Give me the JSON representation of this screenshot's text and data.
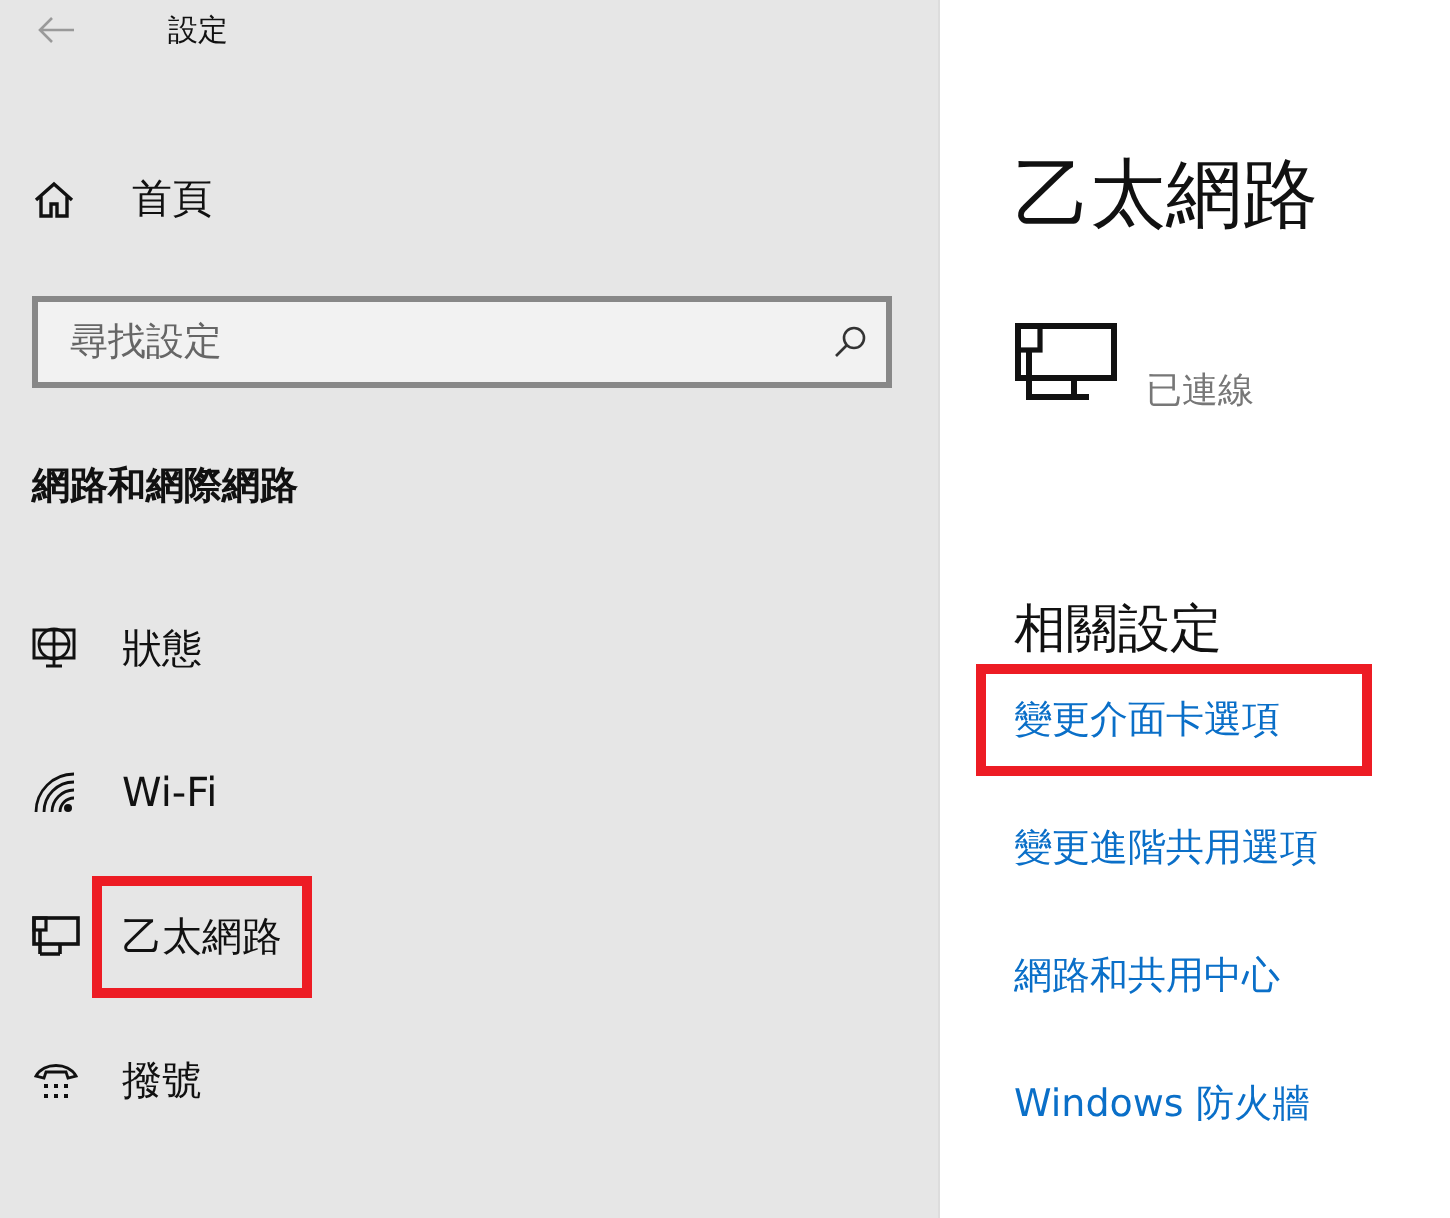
{
  "window": {
    "title": "設定"
  },
  "sidebar": {
    "home": "首頁",
    "search": {
      "placeholder": "尋找設定"
    },
    "section": "網路和網際網路",
    "items": [
      {
        "label": "狀態",
        "kind": "status",
        "highlighted": false
      },
      {
        "label": "Wi-Fi",
        "kind": "wifi",
        "highlighted": false
      },
      {
        "label": "乙太網路",
        "kind": "ethernet",
        "highlighted": true
      },
      {
        "label": "撥號",
        "kind": "dialup",
        "highlighted": false
      }
    ]
  },
  "main": {
    "title": "乙太網路",
    "connection": {
      "status": "已連線"
    },
    "related": {
      "heading": "相關設定",
      "links": [
        {
          "label": "變更介面卡選項",
          "highlighted": true
        },
        {
          "label": "變更進階共用選項",
          "highlighted": false
        },
        {
          "label": "網路和共用中心",
          "highlighted": false
        },
        {
          "label": "Windows 防火牆",
          "highlighted": false
        }
      ]
    }
  }
}
